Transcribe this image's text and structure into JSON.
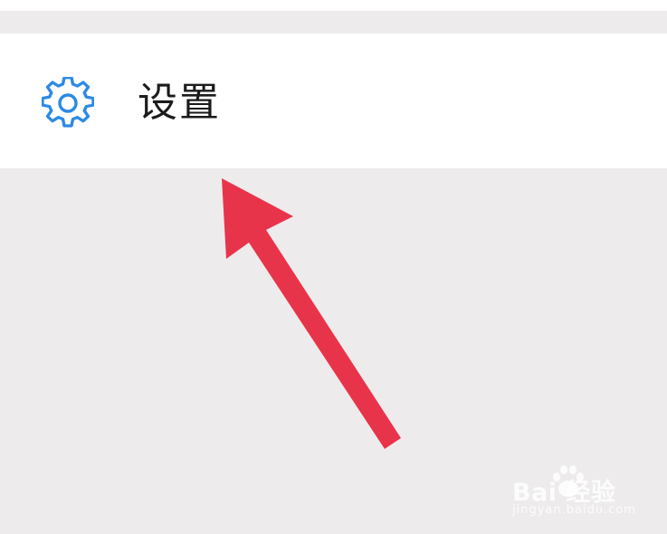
{
  "settings": {
    "label": "设置",
    "icon": "gear-icon",
    "icon_color": "#2c8ae6"
  },
  "annotation": {
    "arrow_color": "#e8344a"
  },
  "watermark": {
    "brand": "Bai 经验",
    "url": "jingyan.baidu.com"
  }
}
